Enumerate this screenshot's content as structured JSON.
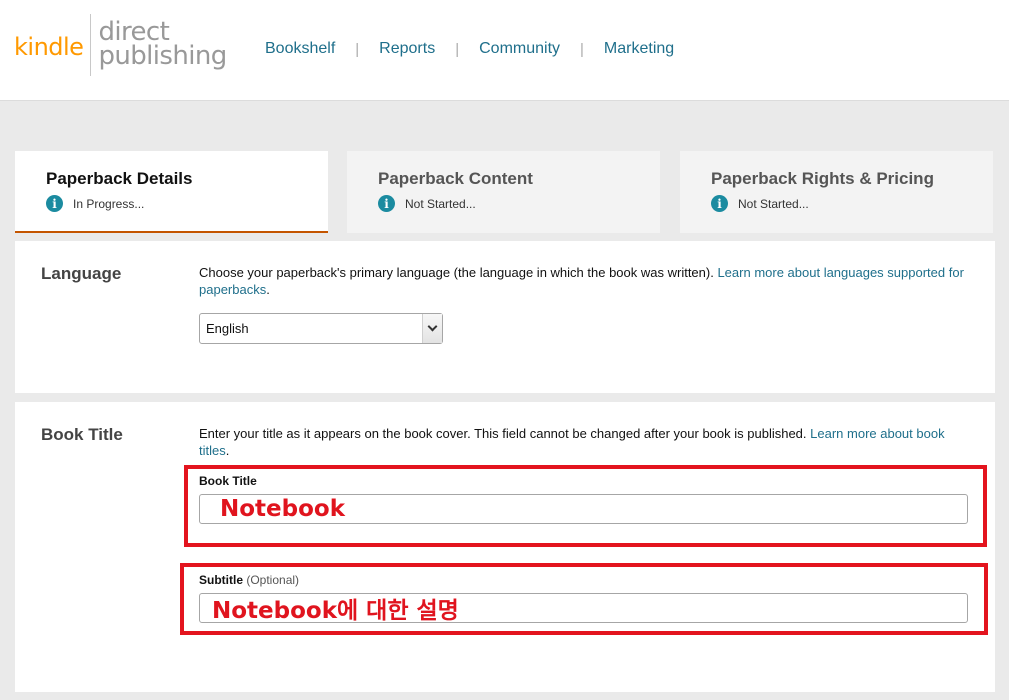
{
  "header": {
    "logo_kindle": "kindle",
    "logo_line1": "direct",
    "logo_line2": "publishing",
    "nav": [
      "Bookshelf",
      "Reports",
      "Community",
      "Marketing"
    ],
    "nav_sep": "|"
  },
  "tabs": [
    {
      "title": "Paperback Details",
      "status": "In Progress..."
    },
    {
      "title": "Paperback Content",
      "status": "Not Started..."
    },
    {
      "title": "Paperback Rights & Pricing",
      "status": "Not Started..."
    }
  ],
  "info_glyph": "i",
  "language": {
    "label": "Language",
    "desc": "Choose your paperback's primary language (the language in which the book was written).",
    "link": "Learn more about languages supported for paperbacks",
    "desc_end": ".",
    "selected": "English"
  },
  "book_title": {
    "label": "Book Title",
    "desc": "Enter your title as it appears on the book cover. This field cannot be changed after your book is published.",
    "link": "Learn more about book titles",
    "desc_end": ".",
    "title_label": "Book Title",
    "title_value": "Notebook",
    "subtitle_label": "Subtitle",
    "subtitle_optional": "(Optional)",
    "subtitle_value": "Notebook에 대한 설명"
  },
  "colors": {
    "accent_orange": "#ff9900",
    "link_teal": "#1f6f8b",
    "info_icon": "#1b8ba0",
    "highlight_red": "#e3141e",
    "active_tab_underline": "#c45500"
  }
}
